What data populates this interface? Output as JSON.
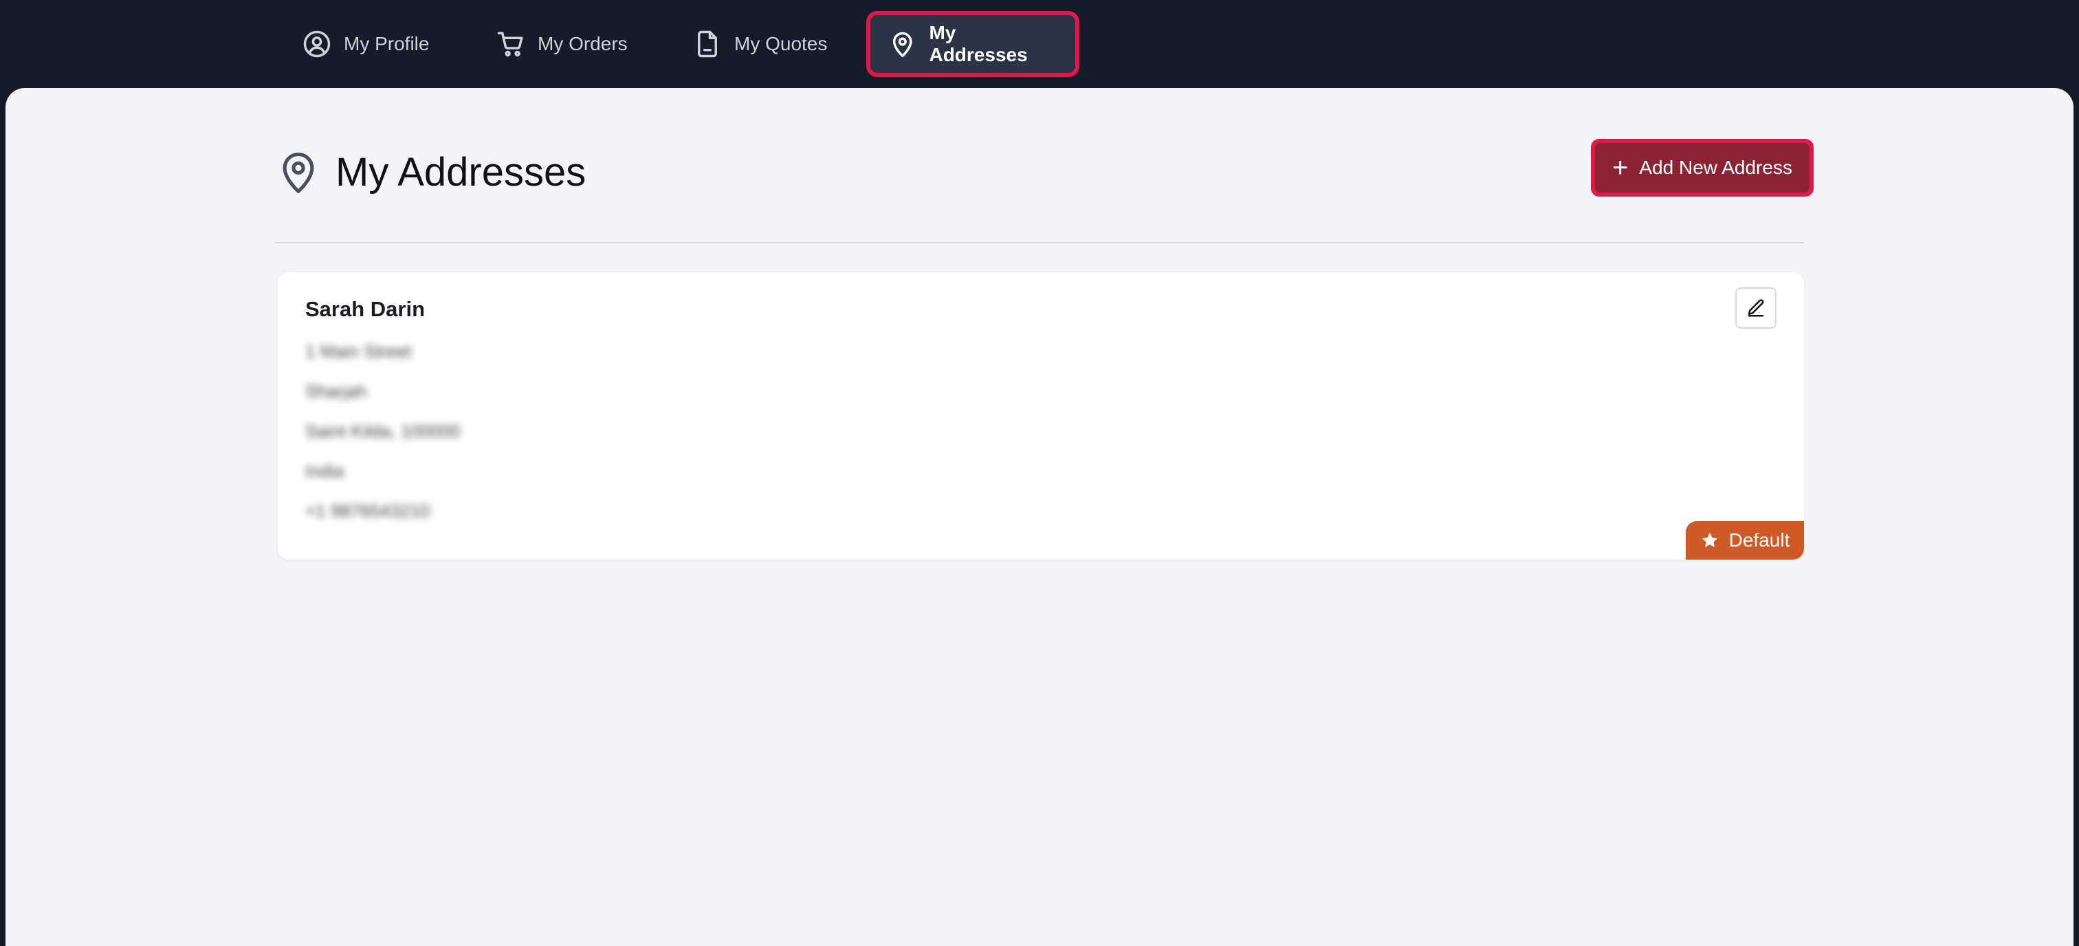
{
  "nav": {
    "items": [
      {
        "label": "My Profile",
        "icon": "user-circle-icon"
      },
      {
        "label": "My Orders",
        "icon": "cart-icon"
      },
      {
        "label": "My Quotes",
        "icon": "document-icon"
      },
      {
        "label": "My Addresses",
        "icon": "map-pin-icon",
        "active": true
      }
    ]
  },
  "page": {
    "title": "My Addresses",
    "add_button_label": "Add New Address"
  },
  "address_card": {
    "name": "Sarah Darin",
    "lines": [
      "1 Main Street",
      "Sharjah",
      "Saint Kilda, 100000",
      "India",
      "+1 9876543210"
    ],
    "lines_blurred": true,
    "badge_label": "Default"
  },
  "colors": {
    "nav_bg": "#171b28",
    "active_tab_bg": "#2d3346",
    "highlight_outline": "#e0184c",
    "add_button_bg": "#8b2335",
    "default_badge_bg": "#d05a26",
    "main_bg": "#f3f3f8"
  }
}
